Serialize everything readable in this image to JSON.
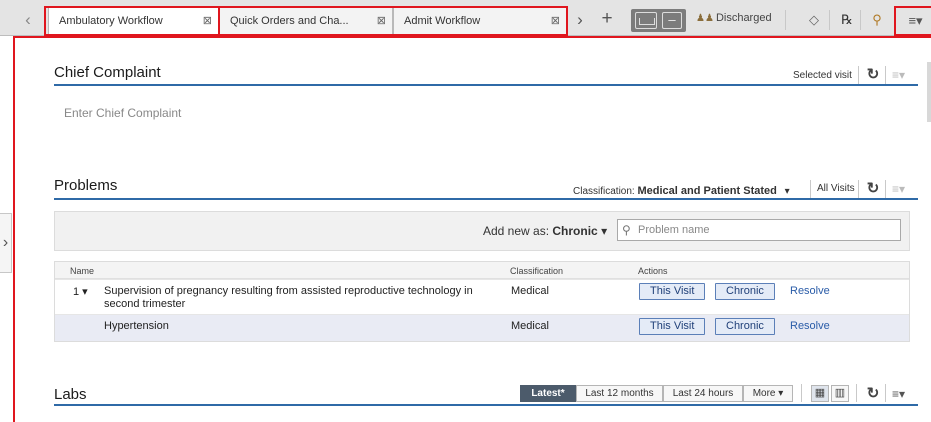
{
  "tabs": [
    {
      "label": "Ambulatory Workflow",
      "close": "⊠"
    },
    {
      "label": "Quick Orders and Cha...",
      "close": "⊠"
    },
    {
      "label": "Admit Workflow",
      "close": "⊠"
    }
  ],
  "toolbar": {
    "back_glyph": "‹",
    "more_glyph": "›",
    "add_glyph": "+",
    "minus_glyph": "–",
    "discharged_label": "Discharged",
    "menu_glyph": "≡▾"
  },
  "chief_complaint": {
    "title": "Chief Complaint",
    "selected_visit": "Selected visit",
    "placeholder": "Enter Chief Complaint"
  },
  "problems": {
    "title": "Problems",
    "classification_label": "Classification:",
    "classification_value": "Medical and Patient Stated",
    "all_visits": "All Visits",
    "add_new_as": "Add new as:",
    "add_new_value": "Chronic",
    "search_placeholder": "Problem name",
    "columns": {
      "name": "Name",
      "classification": "Classification",
      "actions": "Actions"
    },
    "rows": [
      {
        "num": "1",
        "name": "Supervision of pregnancy resulting from assisted reproductive technology in second trimester",
        "classification": "Medical",
        "this_visit": "This Visit",
        "chronic": "Chronic",
        "resolve": "Resolve"
      },
      {
        "num": "",
        "name": "Hypertension",
        "classification": "Medical",
        "this_visit": "This Visit",
        "chronic": "Chronic",
        "resolve": "Resolve"
      }
    ]
  },
  "labs": {
    "title": "Labs",
    "filters": [
      "Latest*",
      "Last 12 months",
      "Last 24 hours",
      "More"
    ]
  },
  "colors": {
    "accent_rule": "#2f6aa7",
    "annotation_red": "#e0161e",
    "chip_border": "#5b7fb8"
  }
}
